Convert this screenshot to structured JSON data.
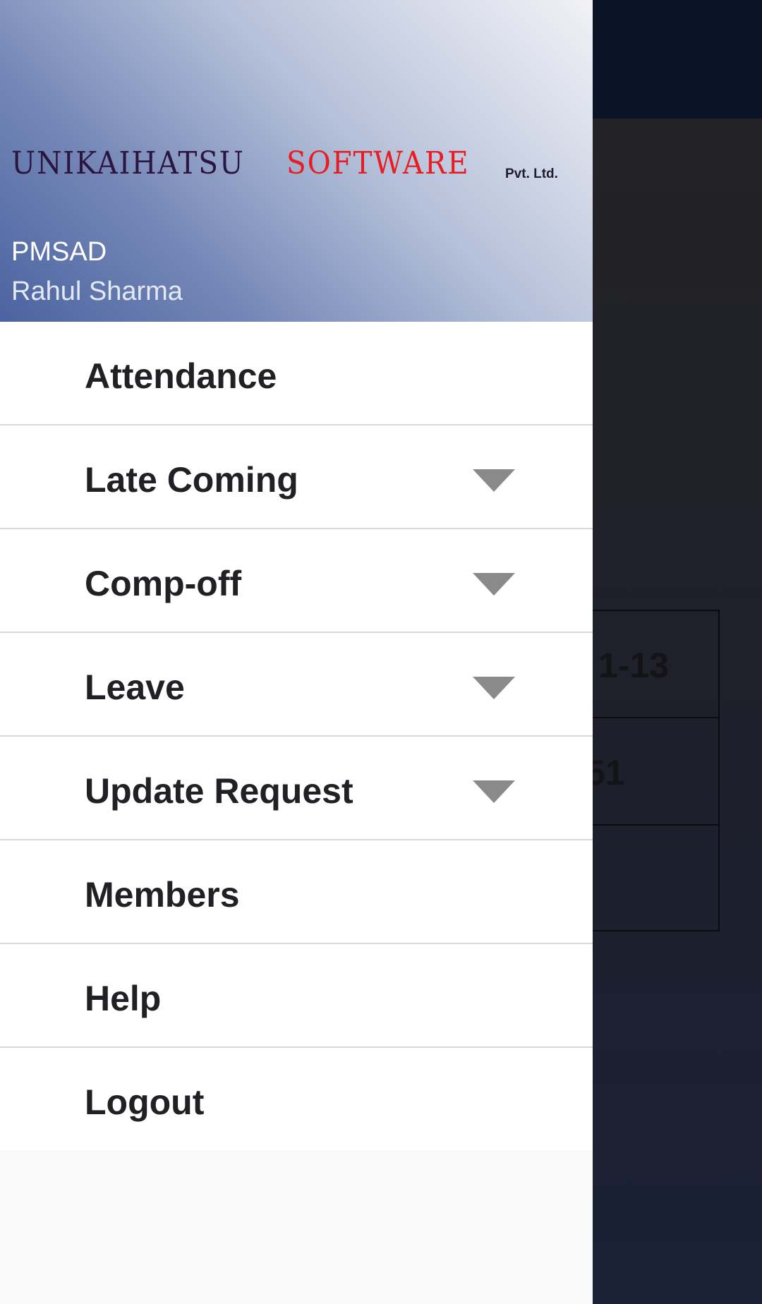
{
  "background": {
    "table_cells": [
      "1-13",
      "51",
      ""
    ]
  },
  "drawer": {
    "logo": {
      "word1": "UNIKAIHATSU",
      "word2": "SOFTWARE",
      "suffix": "Pvt. Ltd."
    },
    "header_title": "PMSAD",
    "header_subtitle": "Rahul Sharma",
    "menu": [
      {
        "label": "Attendance",
        "expandable": false
      },
      {
        "label": "Late Coming",
        "expandable": true
      },
      {
        "label": "Comp-off",
        "expandable": true
      },
      {
        "label": "Leave",
        "expandable": true
      },
      {
        "label": "Update Request",
        "expandable": true
      },
      {
        "label": "Members",
        "expandable": false
      },
      {
        "label": "Help",
        "expandable": false
      },
      {
        "label": "Logout",
        "expandable": false
      }
    ]
  },
  "colors": {
    "header_gradient_start": "#4a63a0",
    "header_gradient_end": "#f2f2f6",
    "logo_word1": "#2b1640",
    "logo_word2": "#e81c23",
    "menu_text": "#202124",
    "caret": "#8a8a8a",
    "scrim": "#1b2033"
  },
  "icons": {
    "expand": "caret-down-icon"
  }
}
